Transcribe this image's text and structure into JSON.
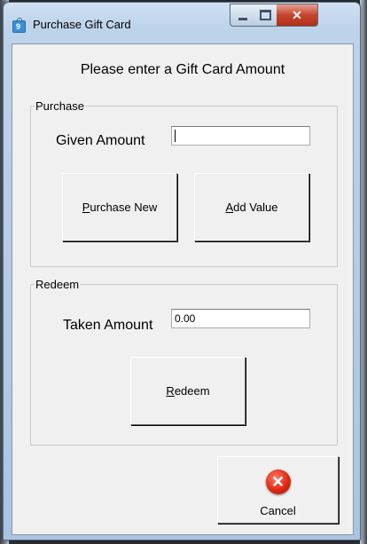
{
  "window": {
    "title": "Purchase Gift Card",
    "controls": {
      "minimize": "",
      "maximize": "",
      "close": "✕"
    }
  },
  "heading": "Please enter a Gift Card Amount",
  "purchase": {
    "group_label": "Purchase",
    "given_amount_label": "Given Amount",
    "given_amount_value": "",
    "purchase_new_hotkey": "P",
    "purchase_new_rest": "urchase New",
    "add_value_hotkey": "A",
    "add_value_rest": "dd Value"
  },
  "redeem": {
    "group_label": "Redeem",
    "taken_amount_label": "Taken Amount",
    "taken_amount_value": "0.00",
    "redeem_hotkey": "R",
    "redeem_rest": "edeem"
  },
  "cancel": {
    "label": "Cancel",
    "icon": "cancel-x-icon",
    "color": "#e22812"
  },
  "icons": {
    "app": "gift-card-icon"
  }
}
